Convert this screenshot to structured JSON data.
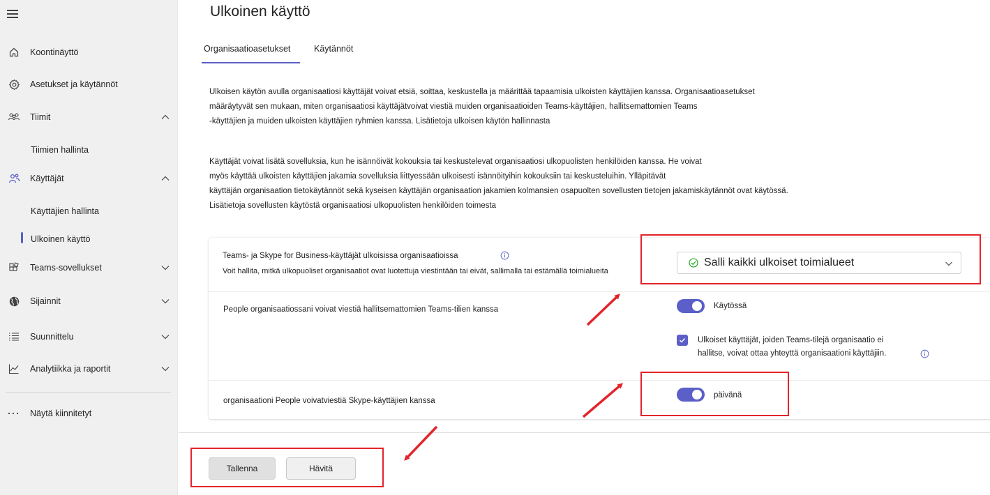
{
  "page": {
    "title": "Ulkoinen käyttö",
    "tabs": [
      {
        "label": "Organisaatioasetukset",
        "active": true
      },
      {
        "label": "Käytännöt",
        "active": false
      }
    ]
  },
  "sidebar": {
    "items": [
      {
        "label": "Koontinäyttö",
        "icon": "home-icon"
      },
      {
        "label": "Asetukset ja käytännöt",
        "icon": "gear-icon"
      },
      {
        "label": "Tiimit",
        "icon": "teams-icon"
      },
      {
        "label": "Tiimien hallinta"
      },
      {
        "label": "Käyttäjät",
        "icon": "users-icon"
      },
      {
        "label": "Käyttäjien hallinta"
      },
      {
        "label": "Ulkoinen käyttö"
      },
      {
        "label": "Teams-sovellukset",
        "icon": "apps-icon"
      },
      {
        "label": "Sijainnit",
        "icon": "globe-icon"
      },
      {
        "label": "Suunnittelu",
        "icon": "list-icon"
      },
      {
        "label": "Analytiikka ja raportit",
        "icon": "chart-icon"
      },
      {
        "label": "Näytä kiinnitetyt",
        "icon": "more-icon"
      }
    ]
  },
  "intro": {
    "p1": [
      "Ulkoisen käytön avulla organisaatiosi käyttäjät voivat etsiä, soittaa, keskustella ja määrittää tapaamisia ulkoisten käyttäjien kanssa. Organisaatioasetukset",
      "määräytyvät sen mukaan, miten organisaatiosi käyttäjätvoivat viestiä muiden organisaatioiden Teams-käyttäjien, hallitsemattomien Teams",
      "-käyttäjien ja muiden ulkoisten käyttäjien ryhmien kanssa. Lisätietoja ulkoisen käytön hallinnasta"
    ],
    "p2": [
      "Käyttäjät voivat lisätä sovelluksia, kun he isännöivät kokouksia tai keskustelevat organisaatiosi ulkopuolisten henkilöiden kanssa. He voivat",
      "myös käyttää ulkoisten käyttäjien jakamia sovelluksia liittyessään ulkoisesti isännöityihin kokouksiin tai keskusteluihin. Ylläpitävät",
      "käyttäjän organisaation tietokäytännöt sekä kyseisen käyttäjän organisaation jakamien kolmansien osapuolten sovellusten tietojen jakamiskäytännöt ovat käytössä.",
      "Lisätietoja sovellusten käytöstä organisaatiosi ulkopuolisten henkilöiden toimesta"
    ]
  },
  "settings": {
    "teams_skype": {
      "label": "Teams- ja Skype for Business-käyttäjät ulkoisissa organisaatioissa",
      "description": "Voit hallita, mitkä ulkopuoliset organisaatiot ovat luotettuja viestintään tai eivät, sallimalla tai estämällä toimialueita",
      "dropdown_value": "Salli kaikki ulkoiset toimialueet"
    },
    "unmanaged": {
      "label": "People organisaatiossani voivat viestiä hallitsemattomien Teams-tilien kanssa",
      "toggle_label": "Käytössä",
      "toggle_on": true,
      "checkbox_label_1": "Ulkoiset käyttäjät, joiden Teams-tilejä organisaatio ei",
      "checkbox_label_2": "hallitse, voivat ottaa yhteyttä organisaationi käyttäjiin.",
      "checkbox_checked": true
    },
    "skype": {
      "label": "organisaationi People voivatviestiä Skype-käyttäjien kanssa",
      "toggle_label": "päivänä",
      "toggle_on": true
    }
  },
  "footer": {
    "save_label": "Tallenna",
    "discard_label": "Hävitä"
  },
  "colors": {
    "accent": "#5b5fc7",
    "annotation": "#e3242b"
  }
}
